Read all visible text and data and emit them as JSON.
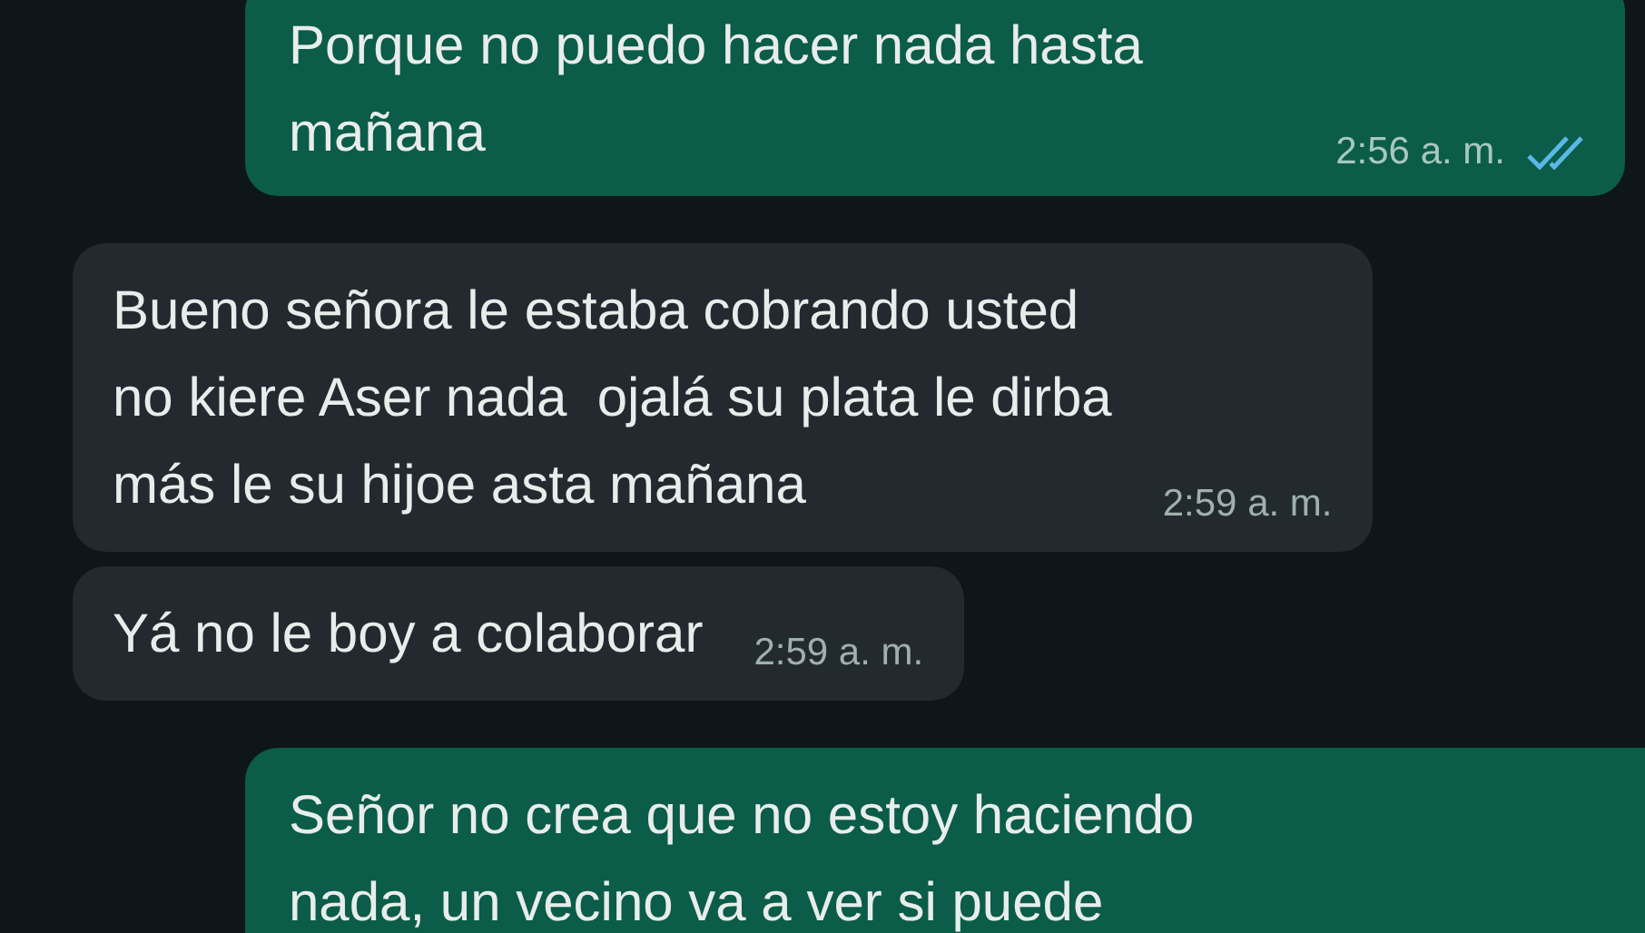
{
  "messages": [
    {
      "kind": "outgoing",
      "text": "Porque no puedo hacer nada hasta\nmañana",
      "time": "2:56 a. m.",
      "read": true
    },
    {
      "kind": "incoming",
      "text": "Bueno señora le estaba cobrando usted\nno kiere Aser nada  ojalá su plata le dirba\nmás le su hijoe asta mañana",
      "time": "2:59 a. m."
    },
    {
      "kind": "incoming",
      "text": "Yá no le boy a colaborar",
      "time": "2:59 a. m."
    },
    {
      "kind": "outgoing",
      "text": "Señor no crea que no estoy haciendo\nnada, un vecino va a ver si puede"
    }
  ]
}
